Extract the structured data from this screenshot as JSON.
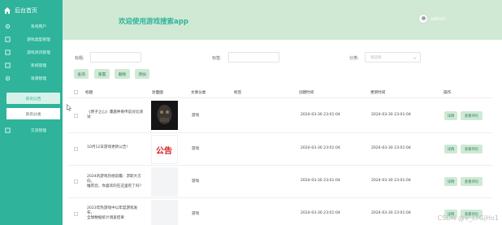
{
  "sidebar": {
    "title": "后台首页",
    "items": [
      {
        "label": "系统用户"
      },
      {
        "label": "游戏类型管理"
      },
      {
        "label": "游戏资讯管理"
      },
      {
        "label": "系统管理"
      },
      {
        "label": "资源管理"
      },
      {
        "label": "资讯公告"
      },
      {
        "label": "资讯分类"
      },
      {
        "label": "交流管理"
      }
    ]
  },
  "header": {
    "title": "欢迎使用游戏搜索app",
    "user": "admin"
  },
  "search": {
    "title_label": "标题:",
    "tag_label": "标签:",
    "category_label": "分类:",
    "category_placeholder": "请选择"
  },
  "toolbar": {
    "query": "查询",
    "reset": "重置",
    "delete": "删除",
    "add": "添加"
  },
  "table": {
    "columns": [
      "标题",
      "封面图",
      "文章分类",
      "标签",
      "创建时间",
      "更新时间",
      "操作"
    ],
    "rows": [
      {
        "title_line1": "《原子之心》遭遇神奇传说对比测试",
        "title_line2": "",
        "category": "游戏",
        "created": "2024-03-30 23:01:04",
        "updated": "2024-03-30 23:01:04",
        "cover": "dark-art"
      },
      {
        "title_line1": "10月12日游戏更新公告!",
        "title_line2": "",
        "category": "游戏",
        "created": "2024-03-30 23:01:04",
        "updated": "2024-03-30 23:01:04",
        "cover": "announcement",
        "cover_text": "公告"
      },
      {
        "title_line1": "2024的游戏热榜前瞻：求职大方向，",
        "title_line2": "推荐您，你喜欢的在这里有了吗?",
        "category": "游戏",
        "created": "2024-03-30 23:01:04",
        "updated": "2024-03-30 23:01:04",
        "cover": "blank"
      },
      {
        "title_line1": "2023年热游戏中以年度游戏发布，",
        "title_line2": "全球数据统计调查结果",
        "category": "游戏",
        "created": "2024-03-30 23:01:04",
        "updated": "2024-03-30 23:01:04",
        "cover": "blank"
      }
    ],
    "action_detail": "详情",
    "action_comment": "查看评论"
  },
  "watermark": "CSDN @V_LYGjHo1",
  "colors": {
    "primary": "#2fb39b",
    "header_bg": "#cfe9d4",
    "button_bg": "#cfe9d4"
  }
}
